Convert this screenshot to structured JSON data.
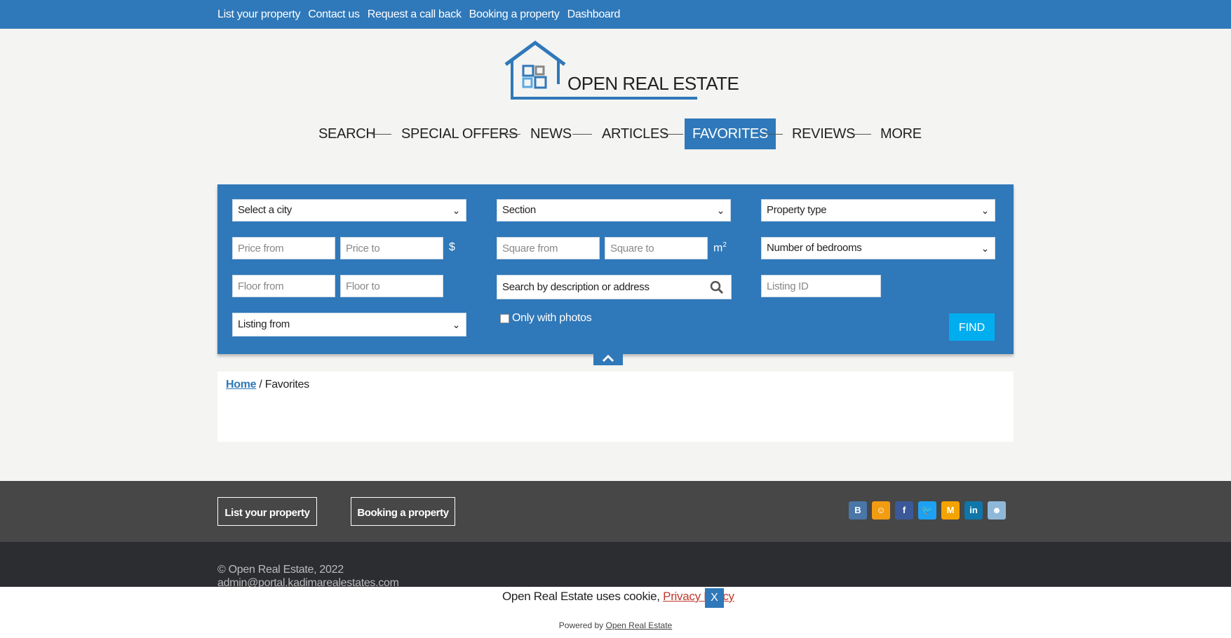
{
  "topbar": {
    "links": [
      "List your property",
      "Contact us",
      "Request a call back",
      "Booking a property",
      "Dashboard"
    ]
  },
  "logo": {
    "text": "OPEN REAL ESTATE"
  },
  "nav": {
    "items": [
      {
        "label": "SEARCH",
        "active": false
      },
      {
        "label": "SPECIAL OFFERS",
        "active": false
      },
      {
        "label": "NEWS",
        "active": false
      },
      {
        "label": "ARTICLES",
        "active": false
      },
      {
        "label": "FAVORITES",
        "active": true
      },
      {
        "label": "REVIEWS",
        "active": false
      },
      {
        "label": "MORE",
        "active": false
      }
    ]
  },
  "search": {
    "city_select": "Select a city",
    "section_select": "Section",
    "property_type_select": "Property type",
    "price_from_placeholder": "Price from",
    "price_to_placeholder": "Price to",
    "price_unit": "$",
    "square_from_placeholder": "Square from",
    "square_to_placeholder": "Square to",
    "square_unit": "m",
    "square_unit_exp": "2",
    "bedrooms_select": "Number of bedrooms",
    "floor_from_placeholder": "Floor from",
    "floor_to_placeholder": "Floor to",
    "description_search_placeholder": "Search by description or address",
    "listing_id_placeholder": "Listing ID",
    "listing_from_select": "Listing from",
    "only_photos_label": "Only with photos",
    "find_button": "FIND"
  },
  "breadcrumb": {
    "home": "Home",
    "separator": "/",
    "current": "Favorites"
  },
  "footer": {
    "list_property_button": "List your property",
    "booking_button": "Booking a property",
    "social_icons": [
      "vk-icon",
      "odnoklassniki-icon",
      "facebook-icon",
      "twitter-icon",
      "moimir-icon",
      "linkedin-icon",
      "reddit-icon"
    ],
    "copyright": "© Open Real Estate, 2022",
    "email": "admin@portal.kadimarealestates.com"
  },
  "cookie": {
    "text": "Open Real Estate uses cookie,",
    "policy_link": "Privacy Policy",
    "close": "X"
  },
  "powered": {
    "prefix": "Powered by",
    "link": "Open Real Estate"
  },
  "colors": {
    "primary": "#2f78b9",
    "find": "#00aeef",
    "footer_top": "#474747",
    "footer_bottom": "#2b2d30"
  }
}
